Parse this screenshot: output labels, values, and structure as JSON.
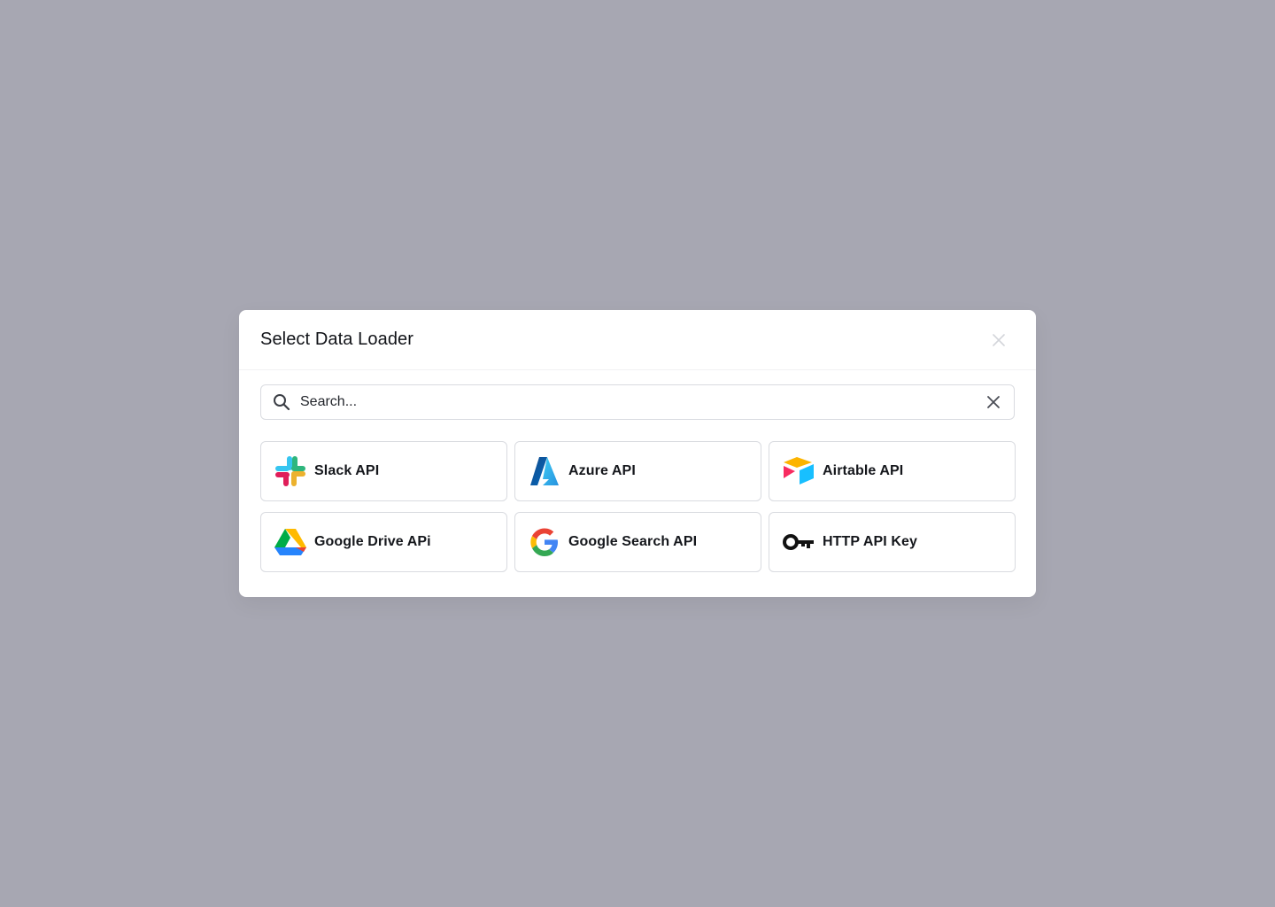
{
  "modal": {
    "title": "Select Data Loader"
  },
  "search": {
    "placeholder": "Search..."
  },
  "loaders": [
    {
      "label": "Slack API",
      "icon": "slack-icon"
    },
    {
      "label": "Azure API",
      "icon": "azure-icon"
    },
    {
      "label": "Airtable API",
      "icon": "airtable-icon"
    },
    {
      "label": "Google Drive APi",
      "icon": "google-drive-icon"
    },
    {
      "label": "Google Search API",
      "icon": "google-icon"
    },
    {
      "label": "HTTP API Key",
      "icon": "key-icon"
    }
  ],
  "colors": {
    "backdrop": "#a7a7b2",
    "border": "#d9dbe0",
    "text": "#15171c"
  }
}
